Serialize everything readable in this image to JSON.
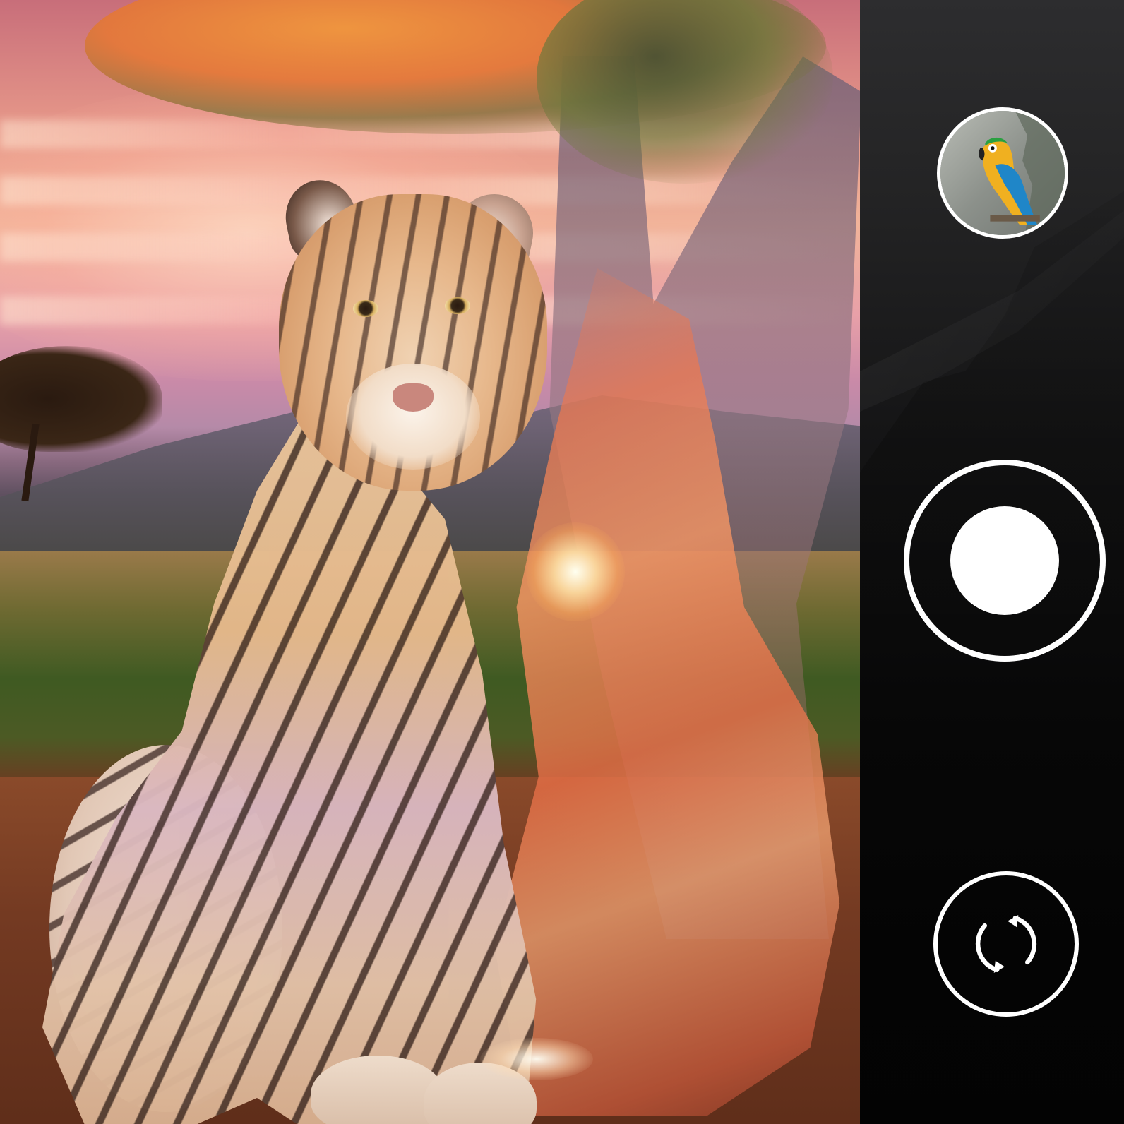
{
  "viewfinder": {
    "scene_description_visible": "",
    "accent_colors": {
      "sky_top": "#c86e7a",
      "sky_glow": "#f2b49a",
      "canyon": "#eb8a58",
      "tiger_fur": "#e6b98c"
    }
  },
  "controls": {
    "thumbnail": {
      "icon": "parrot-photo-thumbnail"
    },
    "shutter": {
      "icon": "shutter-icon"
    },
    "switch_camera": {
      "icon": "switch-camera-icon"
    },
    "colors": {
      "control_stroke": "#ffffff",
      "panel_background": "#141415"
    }
  }
}
